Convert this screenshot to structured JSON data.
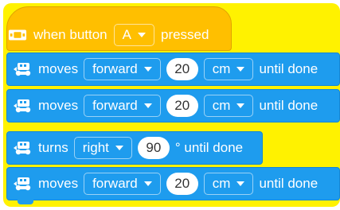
{
  "colors": {
    "hat": "#FFBF00",
    "motion": "#1E9CEE",
    "highlight": "#FFF200",
    "text": "#FFFFFF"
  },
  "hat": {
    "icon": "controller-button-icon",
    "prefix": "when button",
    "button": "A",
    "suffix": "pressed"
  },
  "blocks": [
    {
      "icon": "drivetrain-icon",
      "verb": "moves",
      "direction": "forward",
      "value": "20",
      "unit": "cm",
      "suffix": "until done"
    },
    {
      "icon": "drivetrain-icon",
      "verb": "moves",
      "direction": "forward",
      "value": "20",
      "unit": "cm",
      "suffix": "until done"
    },
    {
      "icon": "drivetrain-icon",
      "verb": "turns",
      "direction": "right",
      "value": "90",
      "suffix": "° until done"
    },
    {
      "icon": "drivetrain-icon",
      "verb": "moves",
      "direction": "forward",
      "value": "20",
      "unit": "cm",
      "suffix": "until done"
    }
  ]
}
